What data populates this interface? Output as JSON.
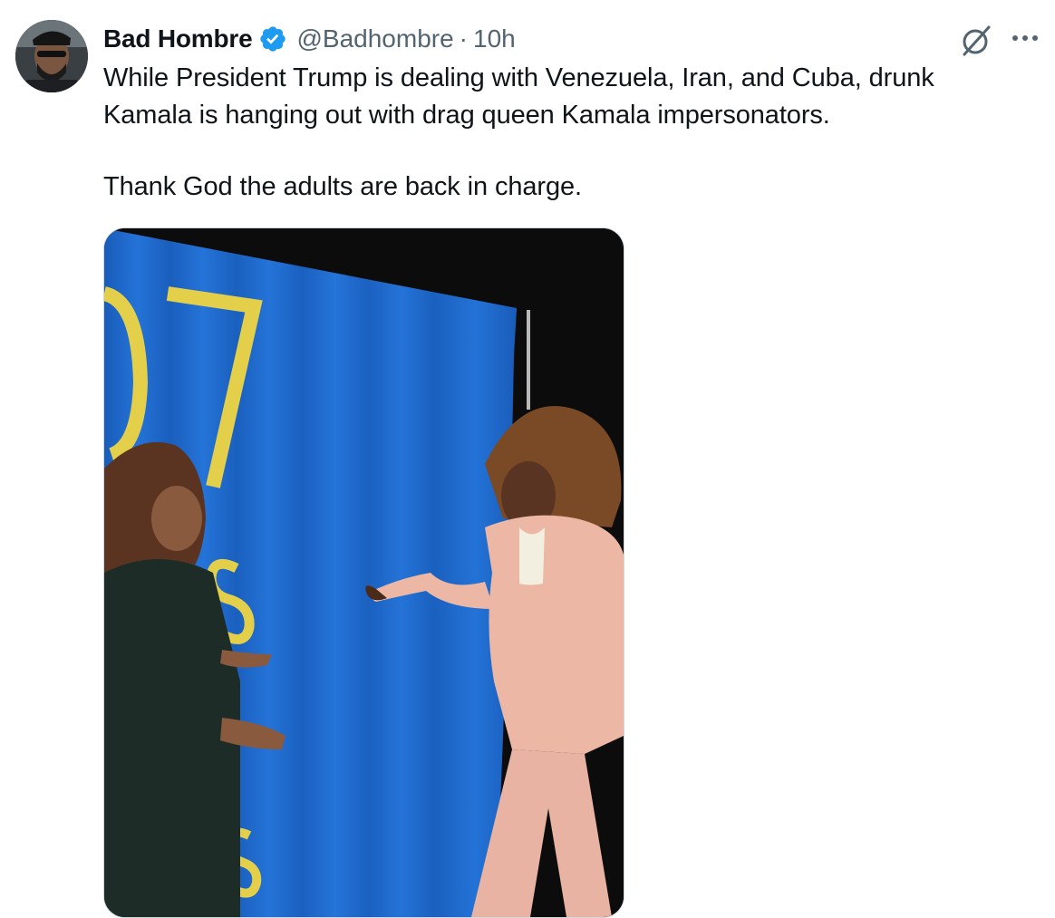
{
  "tweet": {
    "author_name": "Bad Hombre",
    "handle": "@Badhombre",
    "separator": "·",
    "time": "10h",
    "verified": true,
    "text_paragraph_1": "While President Trump is dealing with Venezuela, Iran, and Cuba, drunk Kamala is hanging out with drag queen Kamala impersonators.",
    "text_paragraph_2": "Thank God the adults are back in charge.",
    "media_description": "Video still: two people in front of a blue curtain backdrop"
  },
  "icons": {
    "verified": "verified-badge-icon",
    "grok": "grok-icon",
    "more": "more-options-icon"
  },
  "colors": {
    "verified_blue": "#1d9bf0",
    "secondary_text": "#536471",
    "backdrop_blue": "#1f6bd0",
    "backdrop_gold": "#e3cf4a"
  }
}
